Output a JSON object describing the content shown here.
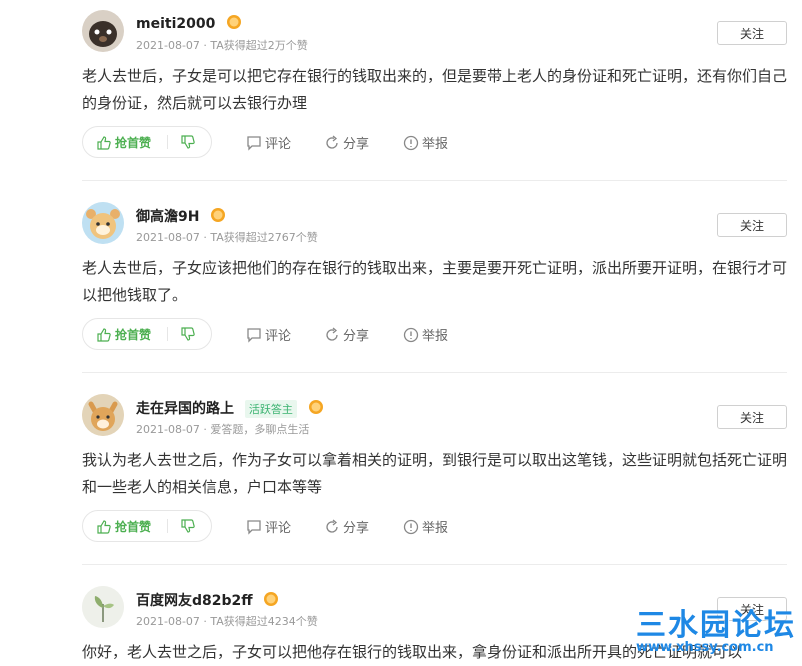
{
  "answers": [
    {
      "username": "meiti2000",
      "meta": "2021-08-07 · TA获得超过2万个赞",
      "follow_label": "关注",
      "content": "老人去世后，子女是可以把它存在银行的钱取出来的，但是要带上老人的身份证和死亡证明，还有你们自己的身份证，然后就可以去银行办理",
      "like_label": "抢首赞",
      "comment_label": "评论",
      "share_label": "分享",
      "report_label": "举报"
    },
    {
      "username": "御高澹9H",
      "meta": "2021-08-07 · TA获得超过2767个赞",
      "follow_label": "关注",
      "content": "老人去世后，子女应该把他们的存在银行的钱取出来，主要是要开死亡证明，派出所要开证明，在银行才可以把他钱取了。",
      "like_label": "抢首赞",
      "comment_label": "评论",
      "share_label": "分享",
      "report_label": "举报"
    },
    {
      "username": "走在异国的路上",
      "tag": "活跃答主",
      "meta": "2021-08-07 · 爱答题，多聊点生活",
      "follow_label": "关注",
      "content": "我认为老人去世之后，作为子女可以拿着相关的证明，到银行是可以取出这笔钱，这些证明就包括死亡证明和一些老人的相关信息，户口本等等",
      "like_label": "抢首赞",
      "comment_label": "评论",
      "share_label": "分享",
      "report_label": "举报"
    },
    {
      "username": "百度网友d82b2ff",
      "meta": "2021-08-07 · TA获得超过4234个赞",
      "follow_label": "关注",
      "content": "你好，老人去世之后，子女可以把他存在银行的钱取出来，拿身份证和派出所开具的死亡证明就可以"
    }
  ],
  "watermark": {
    "text": "三水园论坛",
    "url": "www.xhssy.com.cn"
  },
  "colors": {
    "accent_green": "#4caf50",
    "tag_green": "#3cb371",
    "badge_orange": "#f5a623",
    "watermark_blue": "#1e88e5"
  }
}
